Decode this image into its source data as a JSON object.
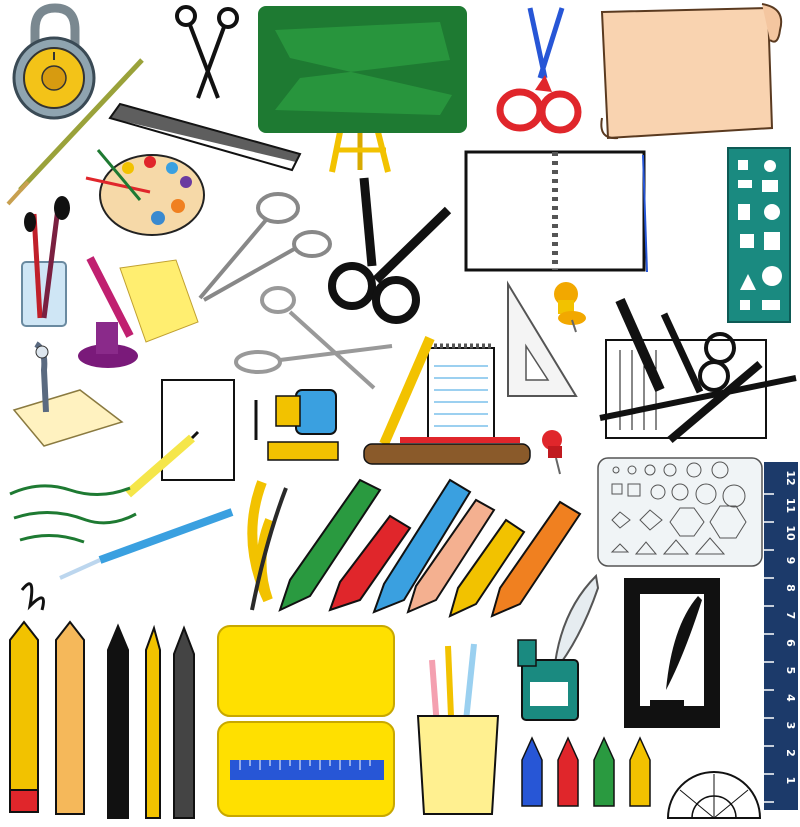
{
  "scene": {
    "background": "#ffffff",
    "items": [
      "combination-lock",
      "scissors-black",
      "chalkboard-easel",
      "scissors-red",
      "parchment-scroll",
      "paint-brush-long",
      "ruler-black",
      "paint-palette",
      "spiral-notebook",
      "stencil-teal",
      "brushes-in-jar",
      "inkwell-note",
      "scissors-silver",
      "scissors-large-black",
      "set-square",
      "push-pin-yellow",
      "art-supplies-group",
      "pen-nib-paper",
      "drawing-pencil-paper",
      "pencil-sharpener",
      "notepad-pencil",
      "push-pin-red",
      "geometry-stencil",
      "vertical-ruler",
      "ink-scribble",
      "fountain-pen-blue",
      "twisted-pencils",
      "pencil-set-diagonal",
      "pencils-vertical",
      "pencil-case-yellow",
      "pencil-cup",
      "quill-inkwell",
      "quill-frame",
      "colored-pencils-short",
      "protractor"
    ]
  },
  "colors": {
    "chalkboard": "#1e7a32",
    "chalkboard_light": "#2a9a40",
    "easel": "#f2c200",
    "scissor_red": "#e0262b",
    "scroll": "#f9d3b0",
    "stencil_teal": "#1a8a80",
    "ruler_navy": "#1c3a6a",
    "case_yellow": "#ffe000",
    "ruler_blue": "#2756d6"
  },
  "vertical_ruler": {
    "numbers": [
      "12",
      "11",
      "10",
      "9",
      "8",
      "7",
      "6",
      "5",
      "4",
      "3",
      "2",
      "1"
    ]
  }
}
